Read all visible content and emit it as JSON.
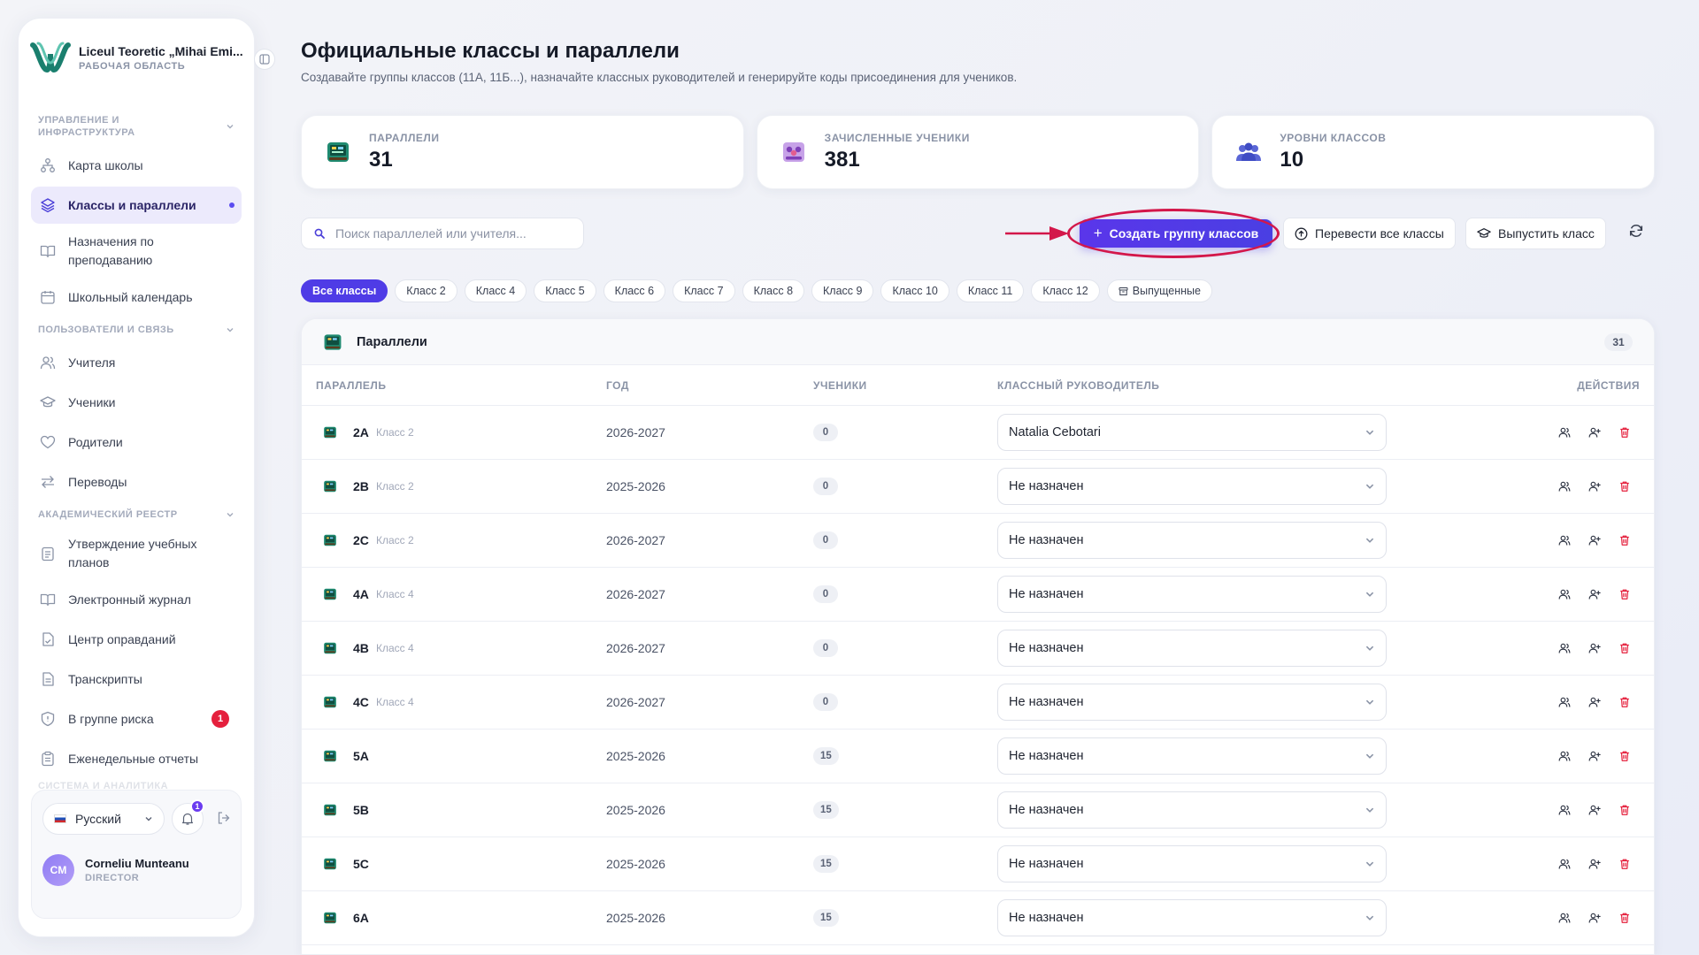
{
  "workspace": {
    "name": "Liceul Teoretic „Mihai Emi...",
    "subtitle": "РАБОЧАЯ ОБЛАСТЬ"
  },
  "sidebar": {
    "sections": [
      {
        "label": "УПРАВЛЕНИЕ И ИНФРАСТРУКТУРА"
      },
      {
        "label": "ПОЛЬЗОВАТЕЛИ И СВЯЗЬ"
      },
      {
        "label": "АКАДЕМИЧЕСКИЙ РЕЕСТР"
      },
      {
        "label": "СИСТЕМА И АНАЛИТИКА"
      }
    ],
    "items": [
      {
        "label": "Карта школы",
        "icon": "sitemap-icon"
      },
      {
        "label": "Классы и параллели",
        "icon": "layers-icon",
        "active": true
      },
      {
        "label": "Назначения по преподаванию",
        "icon": "book-open-icon"
      },
      {
        "label": "Школьный календарь",
        "icon": "calendar-icon"
      },
      {
        "label": "Учителя",
        "icon": "users-icon"
      },
      {
        "label": "Ученики",
        "icon": "graduation-cap-icon"
      },
      {
        "label": "Родители",
        "icon": "heart-icon"
      },
      {
        "label": "Переводы",
        "icon": "arrows-swap-icon"
      },
      {
        "label": "Утверждение учебных планов",
        "icon": "clipboard-icon"
      },
      {
        "label": "Электронный журнал",
        "icon": "book-open-icon"
      },
      {
        "label": "Центр оправданий",
        "icon": "file-check-icon"
      },
      {
        "label": "Транскрипты",
        "icon": "file-text-icon"
      },
      {
        "label": "В группе риска",
        "icon": "shield-icon",
        "badge": "1"
      },
      {
        "label": "Еженедельные отчеты",
        "icon": "clipboard-list-icon"
      }
    ],
    "language": "Русский",
    "notifications": "1",
    "user": {
      "initials": "CM",
      "name": "Corneliu Munteanu",
      "role": "DIRECTOR"
    }
  },
  "page": {
    "title": "Официальные классы и параллели",
    "subtitle": "Создавайте группы классов (11А, 11Б...), назначайте классных руководителей и генерируйте коды присоединения для учеников."
  },
  "stats": [
    {
      "label": "ПАРАЛЛЕЛИ",
      "value": "31",
      "color": "#1f8a70"
    },
    {
      "label": "ЗАЧИСЛЕННЫЕ УЧЕНИКИ",
      "value": "381",
      "color": "#9b59b6"
    },
    {
      "label": "УРОВНИ КЛАССОВ",
      "value": "10",
      "color": "#4a5bd4"
    }
  ],
  "toolbar": {
    "search_placeholder": "Поиск параллелей или учителя...",
    "create_label": "Создать группу классов",
    "promote_label": "Перевести все классы",
    "graduate_label": "Выпустить класс"
  },
  "filters": [
    "Все классы",
    "Класс 2",
    "Класс 4",
    "Класс 5",
    "Класс 6",
    "Класс 7",
    "Класс 8",
    "Класс 9",
    "Класс 10",
    "Класс 11",
    "Класс 12",
    "Выпущенные"
  ],
  "table": {
    "title": "Параллели",
    "count": "31",
    "columns": {
      "name": "ПАРАЛЛЕЛЬ",
      "year": "ГОД",
      "students": "УЧЕНИКИ",
      "teacher": "КЛАССНЫЙ РУКОВОДИТЕЛЬ",
      "actions": "ДЕЙСТВИЯ"
    },
    "rows": [
      {
        "name": "2A",
        "grade": "Класс 2",
        "year": "2026-2027",
        "students": "0",
        "teacher": "Natalia Cebotari"
      },
      {
        "name": "2B",
        "grade": "Класс 2",
        "year": "2025-2026",
        "students": "0",
        "teacher": "Не назначен"
      },
      {
        "name": "2C",
        "grade": "Класс 2",
        "year": "2026-2027",
        "students": "0",
        "teacher": "Не назначен"
      },
      {
        "name": "4A",
        "grade": "Класс 4",
        "year": "2026-2027",
        "students": "0",
        "teacher": "Не назначен"
      },
      {
        "name": "4B",
        "grade": "Класс 4",
        "year": "2026-2027",
        "students": "0",
        "teacher": "Не назначен"
      },
      {
        "name": "4C",
        "grade": "Класс 4",
        "year": "2026-2027",
        "students": "0",
        "teacher": "Не назначен"
      },
      {
        "name": "5A",
        "grade": "",
        "year": "2025-2026",
        "students": "15",
        "teacher": "Не назначен"
      },
      {
        "name": "5B",
        "grade": "",
        "year": "2025-2026",
        "students": "15",
        "teacher": "Не назначен"
      },
      {
        "name": "5C",
        "grade": "",
        "year": "2025-2026",
        "students": "15",
        "teacher": "Не назначен"
      },
      {
        "name": "6A",
        "grade": "",
        "year": "2025-2026",
        "students": "15",
        "teacher": "Не назначен"
      }
    ]
  },
  "colors": {
    "accent": "#4f3ce6",
    "highlight": "#d3174a",
    "danger": "#e5203d"
  }
}
